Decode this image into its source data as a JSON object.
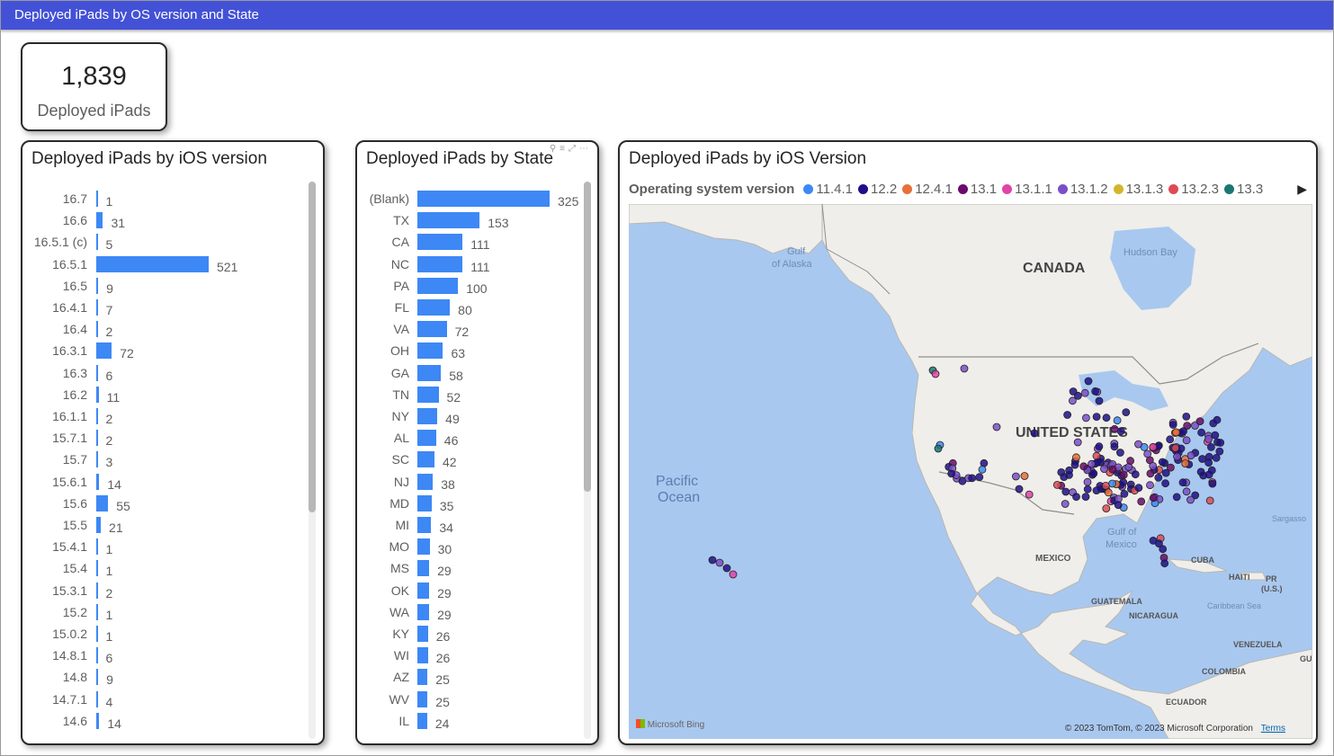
{
  "page": {
    "title": "Deployed iPads by OS version and State"
  },
  "kpi": {
    "value": "1,839",
    "label": "Deployed iPads"
  },
  "ios_chart": {
    "title": "Deployed iPads by iOS version",
    "max": 521,
    "rows": [
      {
        "label": "16.7",
        "value": 1
      },
      {
        "label": "16.6",
        "value": 31
      },
      {
        "label": "16.5.1 (c)",
        "value": 5
      },
      {
        "label": "16.5.1",
        "value": 521
      },
      {
        "label": "16.5",
        "value": 9
      },
      {
        "label": "16.4.1",
        "value": 7
      },
      {
        "label": "16.4",
        "value": 2
      },
      {
        "label": "16.3.1",
        "value": 72
      },
      {
        "label": "16.3",
        "value": 6
      },
      {
        "label": "16.2",
        "value": 11
      },
      {
        "label": "16.1.1",
        "value": 2
      },
      {
        "label": "15.7.1",
        "value": 2
      },
      {
        "label": "15.7",
        "value": 3
      },
      {
        "label": "15.6.1",
        "value": 14
      },
      {
        "label": "15.6",
        "value": 55
      },
      {
        "label": "15.5",
        "value": 21
      },
      {
        "label": "15.4.1",
        "value": 1
      },
      {
        "label": "15.4",
        "value": 1
      },
      {
        "label": "15.3.1",
        "value": 2
      },
      {
        "label": "15.2",
        "value": 1
      },
      {
        "label": "15.0.2",
        "value": 1
      },
      {
        "label": "14.8.1",
        "value": 6
      },
      {
        "label": "14.8",
        "value": 9
      },
      {
        "label": "14.7.1",
        "value": 4
      },
      {
        "label": "14.6",
        "value": 14
      }
    ]
  },
  "state_chart": {
    "title": "Deployed iPads by State",
    "max": 325,
    "rows": [
      {
        "label": "(Blank)",
        "value": 325
      },
      {
        "label": "TX",
        "value": 153
      },
      {
        "label": "CA",
        "value": 111
      },
      {
        "label": "NC",
        "value": 111
      },
      {
        "label": "PA",
        "value": 100
      },
      {
        "label": "FL",
        "value": 80
      },
      {
        "label": "VA",
        "value": 72
      },
      {
        "label": "OH",
        "value": 63
      },
      {
        "label": "GA",
        "value": 58
      },
      {
        "label": "TN",
        "value": 52
      },
      {
        "label": "NY",
        "value": 49
      },
      {
        "label": "AL",
        "value": 46
      },
      {
        "label": "SC",
        "value": 42
      },
      {
        "label": "NJ",
        "value": 38
      },
      {
        "label": "MD",
        "value": 35
      },
      {
        "label": "MI",
        "value": 34
      },
      {
        "label": "MO",
        "value": 30
      },
      {
        "label": "MS",
        "value": 29
      },
      {
        "label": "OK",
        "value": 29
      },
      {
        "label": "WA",
        "value": 29
      },
      {
        "label": "KY",
        "value": 26
      },
      {
        "label": "WI",
        "value": 26
      },
      {
        "label": "AZ",
        "value": 25
      },
      {
        "label": "WV",
        "value": 25
      },
      {
        "label": "IL",
        "value": 24
      }
    ]
  },
  "map": {
    "title": "Deployed iPads by iOS Version",
    "legend_title": "Operating system version",
    "legend": [
      {
        "label": "11.4.1",
        "color": "#3d88f5"
      },
      {
        "label": "12.2",
        "color": "#1f0f8a"
      },
      {
        "label": "12.4.1",
        "color": "#e8703a"
      },
      {
        "label": "13.1",
        "color": "#6b0a6b"
      },
      {
        "label": "13.1.1",
        "color": "#e044a7"
      },
      {
        "label": "13.1.2",
        "color": "#7b4fc9"
      },
      {
        "label": "13.1.3",
        "color": "#d4b52a"
      },
      {
        "label": "13.2.3",
        "color": "#dd4b56"
      },
      {
        "label": "13.3",
        "color": "#187872"
      }
    ],
    "labels": {
      "canada": "CANADA",
      "united_states": "UNITED STATES",
      "hudson_bay": "Hudson Bay",
      "gulf_alaska_1": "Gulf",
      "gulf_alaska_2": "of Alaska",
      "pacific_1": "Pacific",
      "pacific_2": "Ocean",
      "mexico": "MEXICO",
      "gulf_mexico_1": "Gulf of",
      "gulf_mexico_2": "Mexico",
      "cuba": "CUBA",
      "haiti": "HAITI",
      "pr_1": "PR",
      "pr_2": "(U.S.)",
      "caribbean": "Caribbean Sea",
      "sargasso": "Sargasso",
      "guatemala": "GUATEMALA",
      "nicaragua": "NICARAGUA",
      "venezuela": "VENEZUELA",
      "guyana": "GUY",
      "colombia": "COLOMBIA",
      "ecuador": "ECUADOR"
    },
    "attribution": "Microsoft Bing",
    "copyright": "© 2023 TomTom, © 2023 Microsoft Corporation",
    "terms": "Terms"
  }
}
